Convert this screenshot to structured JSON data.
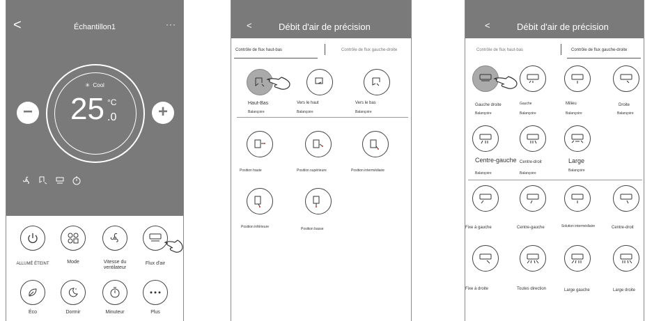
{
  "panel1": {
    "title": "Échantillon1",
    "back": "<",
    "more": "···",
    "mode": "Cool",
    "temp": "25",
    "unit": "°C",
    "decimal": ".0",
    "minus": "−",
    "plus": "+",
    "buttons": [
      "ALLUMÉ ÉTEINT",
      "Mode",
      "Vitesse du ventilateur",
      "Flux d'air",
      "Éco",
      "Dormir",
      "Minuteur",
      "Plus"
    ]
  },
  "panel2": {
    "back": "<",
    "title": "Débit d'air de précision",
    "tab_active": "Contrôle de flux haut-bas",
    "tab_inactive": "Contrôle de flux gauche-droite",
    "modes": [
      {
        "label": "Haut-Bas",
        "sub": "Balançoire"
      },
      {
        "label": "Vers le haut",
        "sub": "Balançoire"
      },
      {
        "label": "Vers le bas",
        "sub": "Balançoire"
      }
    ],
    "positions": [
      "Position haute",
      "Position supérieure",
      "Position intermédiaire",
      "Position inférieure",
      "Position basse"
    ]
  },
  "panel3": {
    "back": "<",
    "title": "Débit d'air de précision",
    "tab_inactive": "Contrôle de flux haut-bas",
    "tab_active": "Contrôle de flux gauche-droite",
    "swing": [
      {
        "label": "Gauche droite",
        "sub": "Balançoire"
      },
      {
        "label": "Gauche",
        "sub": "Balançoire"
      },
      {
        "label": "Milieu",
        "sub": "Balançoire"
      },
      {
        "label": "Droite",
        "sub": "Balançoire"
      },
      {
        "label": "Centre-gauche",
        "sub": "Balançoire"
      },
      {
        "label": "Centre-droit",
        "sub": "Balançoire"
      },
      {
        "label": "Large",
        "sub": "Balançoire"
      }
    ],
    "fixed": [
      "Fixe à gauche",
      "Centre-gauche",
      "Solution intermédiaire",
      "Centre-droit",
      "Fixe à droite",
      "Toutes direction",
      "Large gauche",
      "Large droite"
    ]
  }
}
